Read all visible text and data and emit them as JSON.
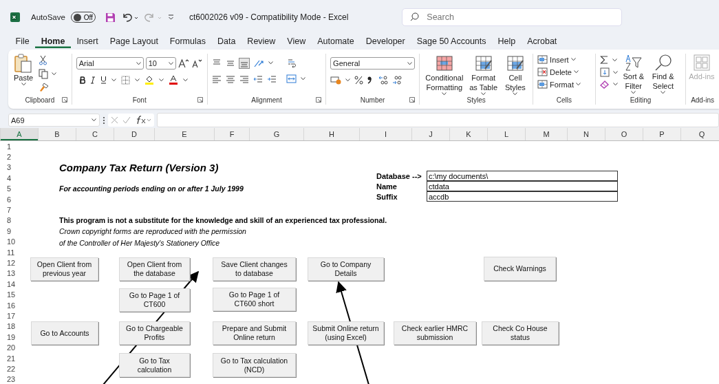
{
  "title_bar": {
    "autosave_label": "AutoSave",
    "autosave_toggle": {
      "label": "Off",
      "on": false
    },
    "document_title": "ct6002026 v09  -  Compatibility Mode  -  Excel",
    "search": {
      "placeholder": "Search"
    }
  },
  "menu_tabs": [
    {
      "label": "File",
      "selected": false
    },
    {
      "label": "Home",
      "selected": true
    },
    {
      "label": "Insert",
      "selected": false
    },
    {
      "label": "Page Layout",
      "selected": false
    },
    {
      "label": "Formulas",
      "selected": false
    },
    {
      "label": "Data",
      "selected": false
    },
    {
      "label": "Review",
      "selected": false
    },
    {
      "label": "View",
      "selected": false
    },
    {
      "label": "Automate",
      "selected": false
    },
    {
      "label": "Developer",
      "selected": false
    },
    {
      "label": "Sage 50 Accounts",
      "selected": false
    },
    {
      "label": "Help",
      "selected": false
    },
    {
      "label": "Acrobat",
      "selected": false
    }
  ],
  "ribbon": {
    "clipboard": {
      "paste": "Paste",
      "label": "Clipboard"
    },
    "font": {
      "font_name": "Arial",
      "font_size": "10",
      "label": "Font"
    },
    "alignment": {
      "label": "Alignment"
    },
    "number": {
      "format": "General",
      "label": "Number"
    },
    "styles": {
      "buttons": [
        "Conditional Formatting",
        "Format as Table",
        "Cell Styles"
      ],
      "label": "Styles"
    },
    "cells": {
      "buttons": [
        "Insert",
        "Delete",
        "Format"
      ],
      "label": "Cells"
    },
    "editing": {
      "buttons": [
        "Sort & Filter",
        "Find & Select"
      ],
      "label": "Editing"
    },
    "add_ins": {
      "button": {
        "label": "Add-ins",
        "disabled": true
      },
      "label": "Add-ins"
    }
  },
  "formula_bar": {
    "name_box": "A69"
  },
  "sheet": {
    "columns": [
      {
        "label": "A",
        "selected": true
      },
      {
        "label": "B",
        "selected": false
      },
      {
        "label": "C",
        "selected": false
      },
      {
        "label": "D",
        "selected": false
      },
      {
        "label": "E",
        "selected": false
      },
      {
        "label": "F",
        "selected": false
      },
      {
        "label": "G",
        "selected": false
      },
      {
        "label": "H",
        "selected": false
      },
      {
        "label": "I",
        "selected": false
      },
      {
        "label": "J",
        "selected": false
      },
      {
        "label": "K",
        "selected": false
      },
      {
        "label": "L",
        "selected": false
      },
      {
        "label": "M",
        "selected": false
      },
      {
        "label": "N",
        "selected": false
      },
      {
        "label": "O",
        "selected": false
      },
      {
        "label": "P",
        "selected": false
      },
      {
        "label": "Q",
        "selected": false
      }
    ],
    "rows": [
      "1",
      "2",
      "3",
      "4",
      "5",
      "6",
      "7",
      "8",
      "9",
      "10",
      "11",
      "12",
      "13",
      "14",
      "15",
      "16",
      "17",
      "18",
      "19",
      "20",
      "21",
      "22",
      "23"
    ],
    "title": "Company Tax Return (Version 3)",
    "subtitle": "For accounting periods ending on or after 1 July 1999",
    "notice": "This program is not a substitute for the knowledge and skill of an experienced tax professional.",
    "copyright_lines": [
      "Crown copyright forms are reproduced with the permission",
      "of the Controller of Her Majesty's Stationery Office"
    ],
    "database_fields": [
      {
        "label": "Database -->",
        "value": "c:\\my documents\\"
      },
      {
        "label": "Name",
        "value": "ctdata"
      },
      {
        "label": "Suffix",
        "value": "accdb"
      }
    ],
    "buttons": [
      "Open Client from previous year",
      "Open Client from the database",
      "Save Client changes to database",
      "Go to Company Details",
      "Check Warnings",
      "Go to Page 1 of CT600",
      "Go to Page 1 of CT600 short",
      "Go to Accounts",
      "Go to Chargeable Profits",
      "Prepare and Submit Online return",
      "Submit Online return (using Excel)",
      "Check earlier HMRC submission",
      "Check Co House status",
      "Go to Tax calculation",
      "Go to Tax calculation (NCD)"
    ]
  }
}
